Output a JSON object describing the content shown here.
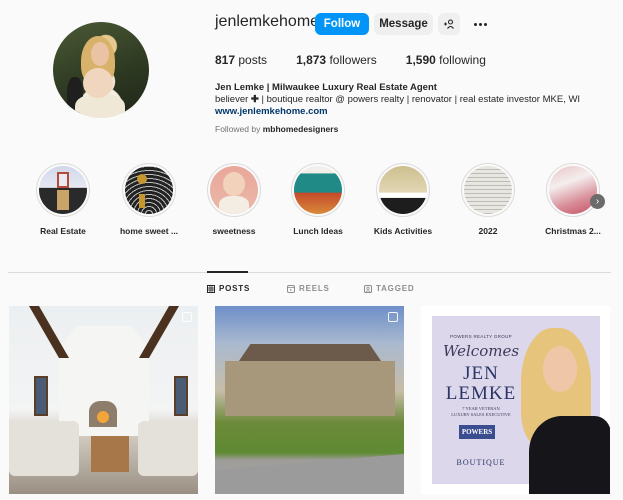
{
  "profile": {
    "username": "jenlemkehome",
    "follow_label": "Follow",
    "message_label": "Message",
    "add_user_icon": "add-user-icon",
    "more_icon": "more-options-icon",
    "stats": {
      "posts_count": "817",
      "posts_label": "posts",
      "followers_count": "1,873",
      "followers_label": "followers",
      "following_count": "1,590",
      "following_label": "following"
    },
    "bio": {
      "name": "Jen Lemke | Milwaukee Luxury Real Estate Agent",
      "line1_prefix": "believer",
      "line1_symbol": "✚",
      "line1_suffix": " | boutique realtor @ powers realty | renovator | real estate investor MKE, WI",
      "website": "www.jenlemkehome.com"
    },
    "followed_by_prefix": "Followed by ",
    "followed_by_user": "mbhomedesigners"
  },
  "highlights": [
    {
      "label": "Real Estate"
    },
    {
      "label": "home sweet ..."
    },
    {
      "label": "sweetness"
    },
    {
      "label": "Lunch Ideas"
    },
    {
      "label": "Kids Activities"
    },
    {
      "label": "2022"
    },
    {
      "label": "Christmas 2..."
    }
  ],
  "highlights_next_icon": "chevron-right-icon",
  "tabs": [
    {
      "label": "POSTS",
      "icon": "grid-icon",
      "active": true
    },
    {
      "label": "REELS",
      "icon": "reels-icon",
      "active": false
    },
    {
      "label": "TAGGED",
      "icon": "tagged-icon",
      "active": false
    }
  ],
  "posts": [
    {
      "description": "Living room with vaulted ceiling and fireplace",
      "multi": true
    },
    {
      "description": "Tudor style stone house with lawn",
      "multi": true
    },
    {
      "description": "Welcome announcement graphic",
      "multi": false,
      "overlay": {
        "company": "POWERS REALTY GROUP",
        "script": "Welcomes",
        "name_line1": "JEN",
        "name_line2": "LEMKE",
        "tagline1": "7 YEAR VETERAN",
        "tagline2": "LUXURY SALES EXECUTIVE",
        "logo": "POWERS",
        "footer": "BOUTIQUE"
      }
    }
  ],
  "colors": {
    "follow_button": "#0095f6",
    "link": "#00376b",
    "background": "#fafafa"
  }
}
